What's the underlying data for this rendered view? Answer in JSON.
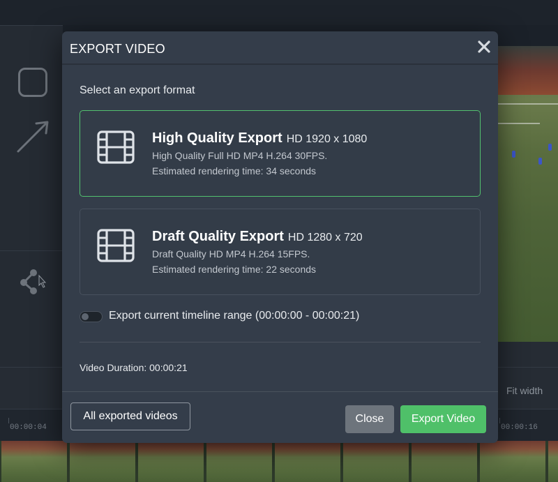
{
  "background": {
    "fit_width_label": "Fit width",
    "ruler_labels": [
      "00:00:04",
      "00:00:16"
    ],
    "tools": [
      "rectangle-icon",
      "arrow-icon",
      "node-icon"
    ]
  },
  "modal": {
    "title": "EXPORT VIDEO",
    "close_icon": "close-icon",
    "prompt": "Select an export format",
    "options": [
      {
        "name": "High Quality Export",
        "resolution": "HD 1920 x 1080",
        "description": "High Quality Full HD MP4 H.264 30FPS.",
        "time": "Estimated rendering time: 34 seconds",
        "selected": true,
        "icon": "film-icon"
      },
      {
        "name": "Draft Quality Export",
        "resolution": "HD 1280 x 720",
        "description": "Draft Quality HD MP4 H.264 15FPS.",
        "time": "Estimated rendering time: 22 seconds",
        "selected": false,
        "icon": "film-icon"
      }
    ],
    "toggle_label": "Export current timeline range (00:00:00 - 00:00:21)",
    "toggle_on": false,
    "duration": "Video Duration: 00:00:21",
    "buttons": {
      "all_exported": "All exported videos",
      "close": "Close",
      "export": "Export Video"
    }
  },
  "colors": {
    "accent_green": "#4fc069",
    "modal_bg": "#343d4a",
    "selected_border": "#52c26f"
  }
}
